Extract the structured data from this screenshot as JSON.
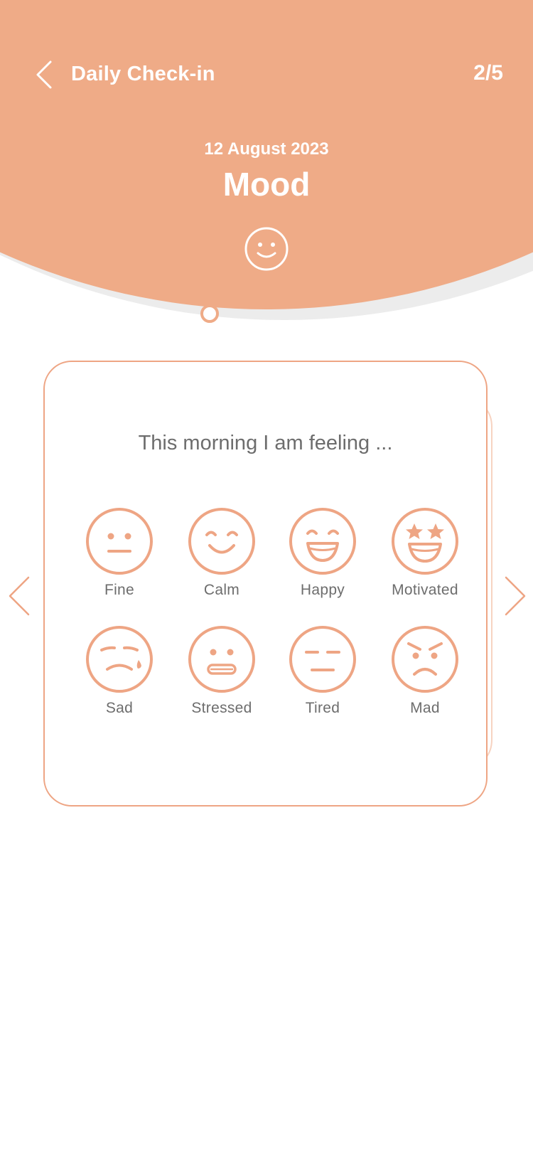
{
  "theme": {
    "accent": "#efab87",
    "accent_stroke": "#eea584",
    "text_gray": "#6d6d6d"
  },
  "header": {
    "title": "Daily Check-in",
    "step": "2/5",
    "date": "12 August 2023",
    "section": "Mood",
    "section_icon": "smiley-icon",
    "back_icon": "chevron-left-icon"
  },
  "card": {
    "prompt": "This morning I am feeling ...",
    "moods": [
      {
        "label": "Fine",
        "icon": "neutral-face-icon"
      },
      {
        "label": "Calm",
        "icon": "calm-face-icon"
      },
      {
        "label": "Happy",
        "icon": "happy-face-icon"
      },
      {
        "label": "Motivated",
        "icon": "star-eyes-face-icon"
      },
      {
        "label": "Sad",
        "icon": "sad-face-icon"
      },
      {
        "label": "Stressed",
        "icon": "stressed-face-icon"
      },
      {
        "label": "Tired",
        "icon": "tired-face-icon"
      },
      {
        "label": "Mad",
        "icon": "mad-face-icon"
      }
    ]
  },
  "navigation": {
    "prev_icon": "chevron-left-icon",
    "next_icon": "chevron-right-icon"
  }
}
